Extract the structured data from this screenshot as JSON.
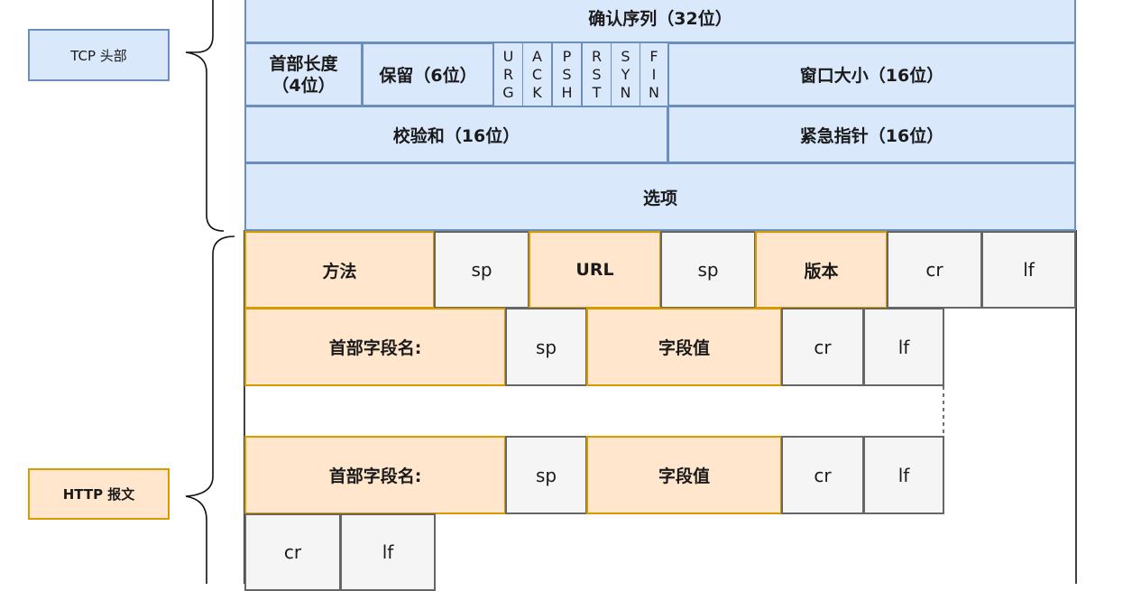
{
  "side_labels": {
    "tcp": "TCP 头部",
    "http": "HTTP 报文"
  },
  "tcp": {
    "ack_seq": "确认序列（32位）",
    "header_len_1": "首部长度",
    "header_len_2": "（4位）",
    "reserved": "保留（6位）",
    "flags": [
      [
        "U",
        "R",
        "G"
      ],
      [
        "A",
        "C",
        "K"
      ],
      [
        "P",
        "S",
        "H"
      ],
      [
        "R",
        "S",
        "T"
      ],
      [
        "S",
        "Y",
        "N"
      ],
      [
        "F",
        "I",
        "N"
      ]
    ],
    "window": "窗口大小（16位）",
    "checksum": "校验和（16位）",
    "urgent": "紧急指针（16位）",
    "options": "选项"
  },
  "http": {
    "request_line": {
      "method": "方法",
      "sp1": "sp",
      "url": "URL",
      "sp2": "sp",
      "version": "版本",
      "cr": "cr",
      "lf": "lf"
    },
    "header_1": {
      "name": "首部字段名:",
      "sp": "sp",
      "value": "字段值",
      "cr": "cr",
      "lf": "lf"
    },
    "header_2": {
      "name": "首部字段名:",
      "sp": "sp",
      "value": "字段值",
      "cr": "cr",
      "lf": "lf"
    },
    "blank_line": {
      "cr": "cr",
      "lf": "lf"
    }
  }
}
